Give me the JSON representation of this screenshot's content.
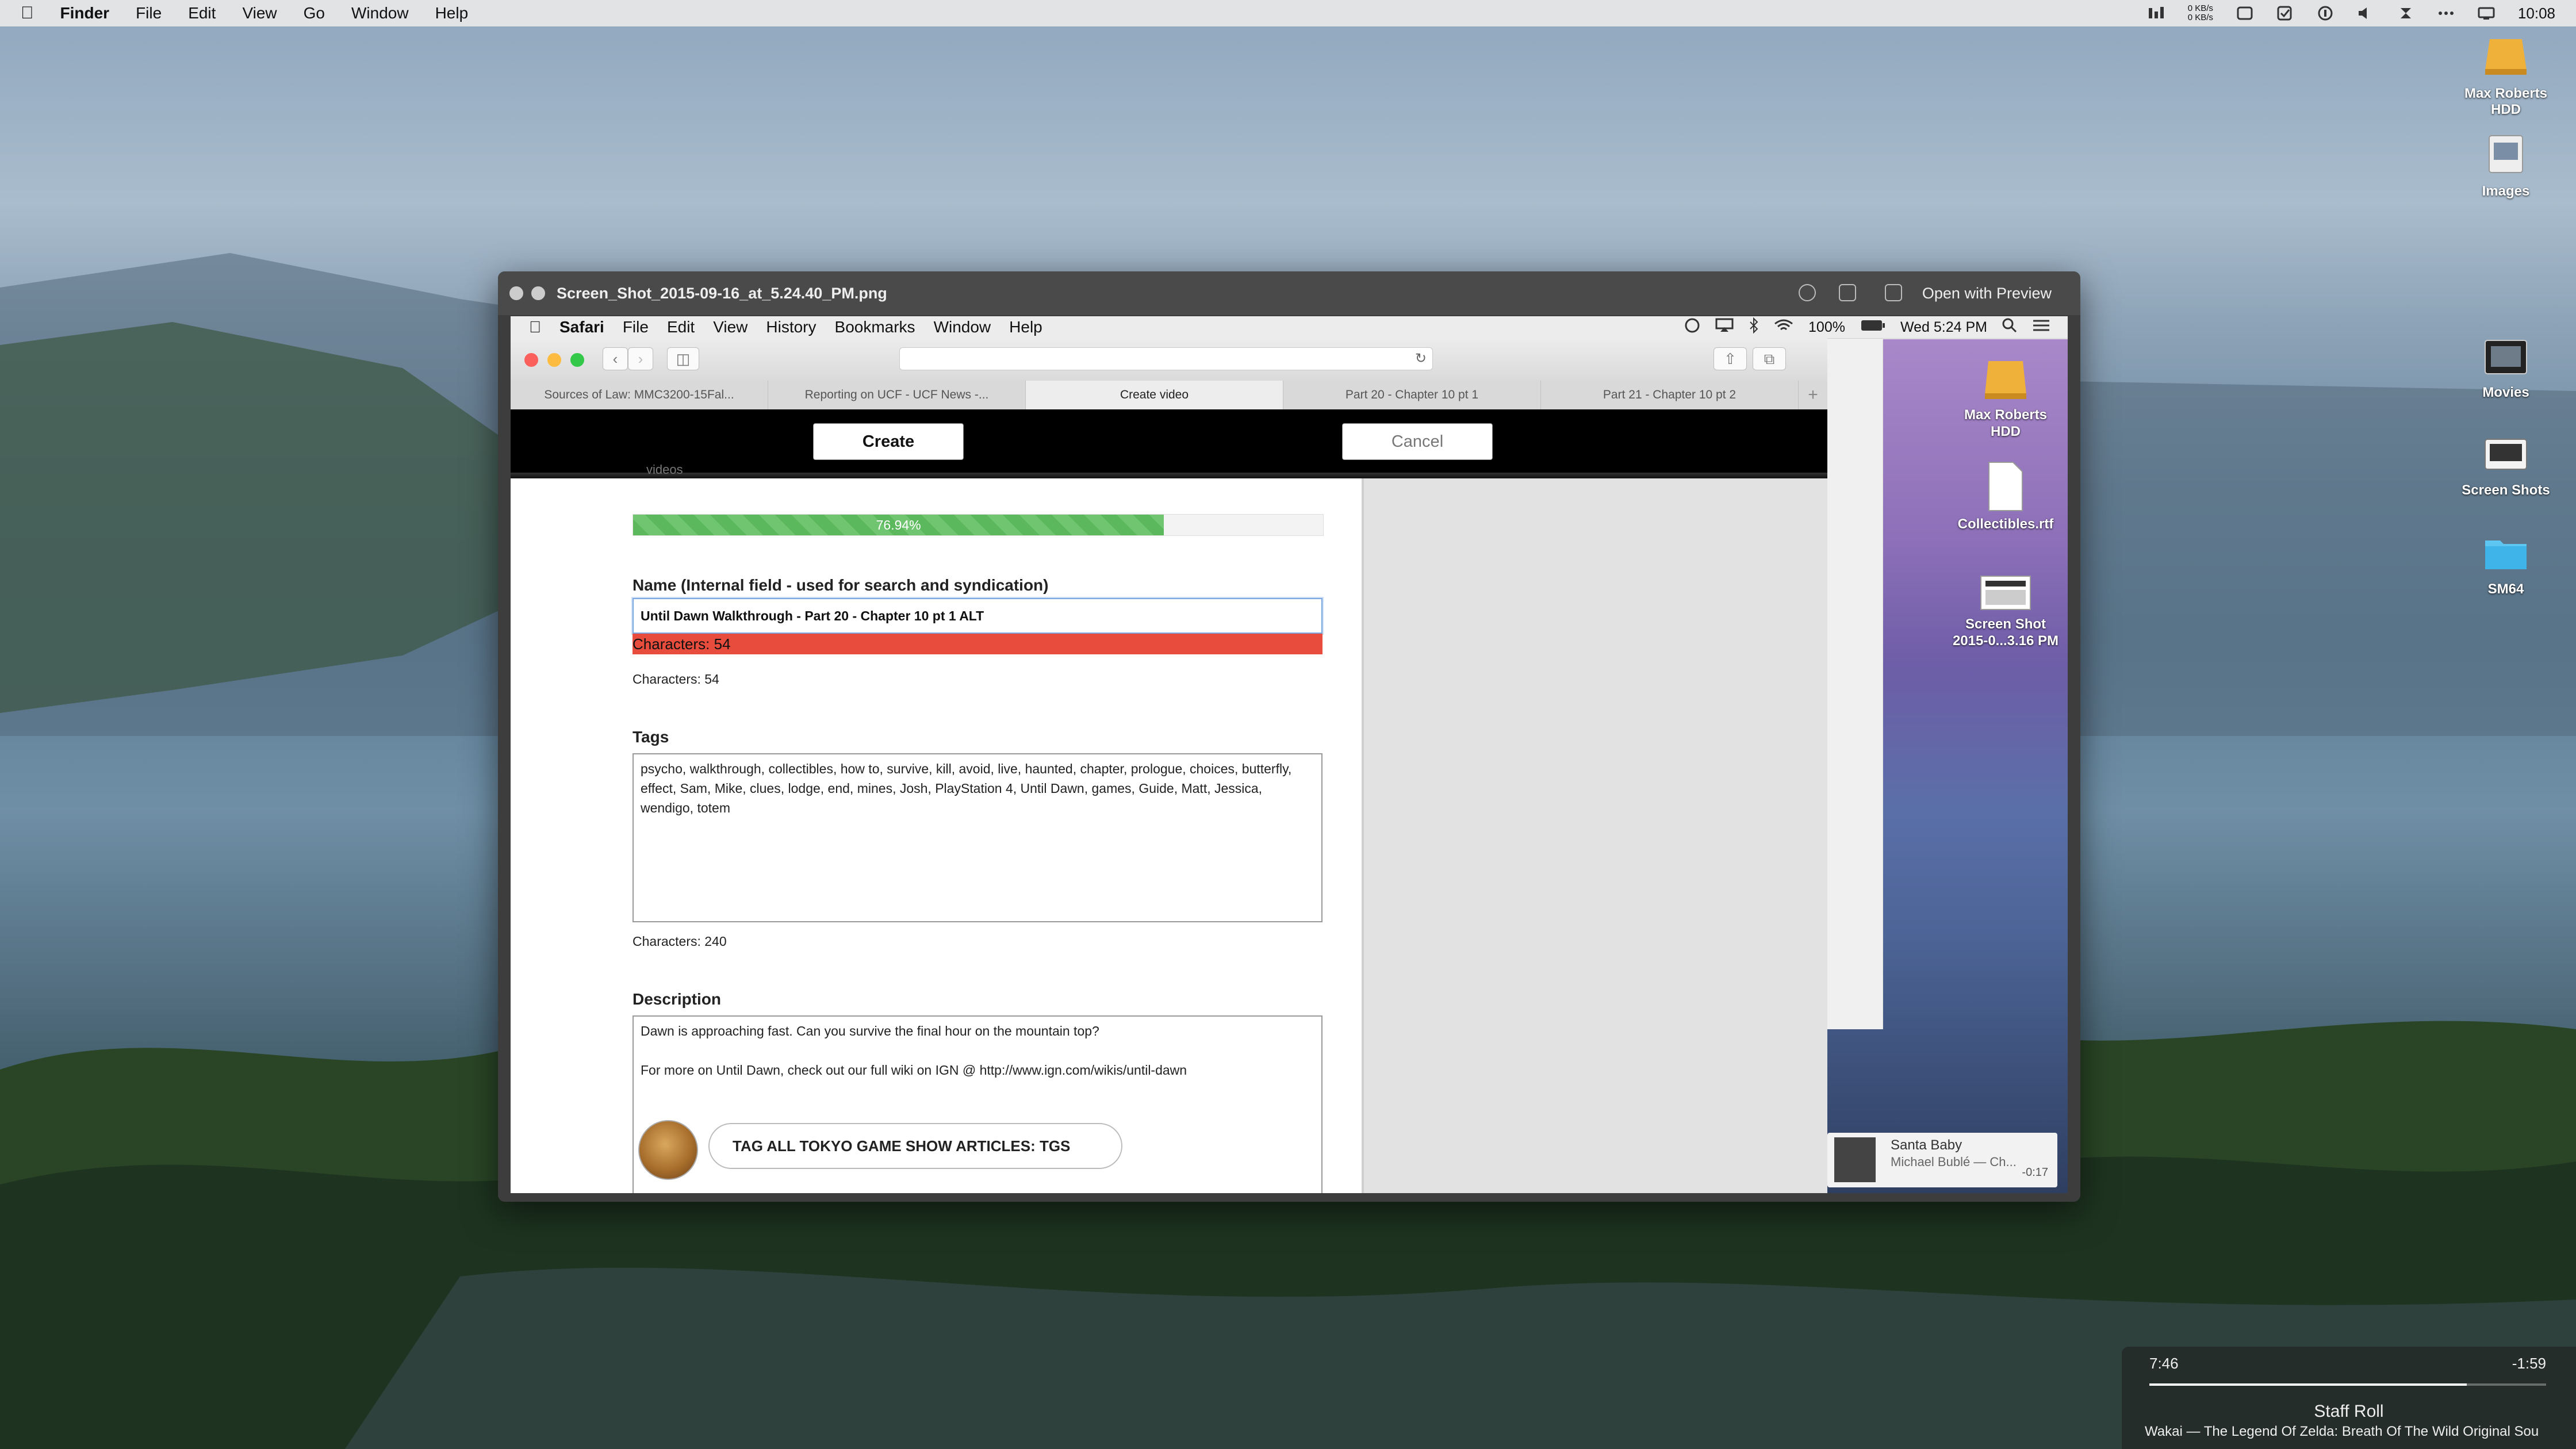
{
  "menubar": {
    "app": "Finder",
    "items": [
      "File",
      "Edit",
      "View",
      "Go",
      "Window",
      "Help"
    ],
    "net_up": "0 KB/s",
    "net_down": "0 KB/s",
    "clock": "10:08"
  },
  "desktop_icons": [
    {
      "label": "Max Roberts HDD",
      "icon": "hard-drive-icon"
    },
    {
      "label": "Images",
      "icon": "folder-icon"
    },
    {
      "label": "Movies",
      "icon": "folder-icon"
    },
    {
      "label": "Screen Shots",
      "icon": "folder-icon"
    },
    {
      "label": "SM64",
      "icon": "folder-icon"
    }
  ],
  "preview": {
    "filename": "Screen_Shot_2015-09-16_at_5.24.40_PM.png",
    "open_with": "Open with Preview"
  },
  "inner_menubar": {
    "app": "Safari",
    "items": [
      "File",
      "Edit",
      "View",
      "History",
      "Bookmarks",
      "Window",
      "Help"
    ],
    "battery": "100%",
    "clock": "Wed 5:24 PM"
  },
  "inner_desktop_icons": [
    {
      "label": "Max Roberts HDD"
    },
    {
      "label": "Collectibles.rtf"
    },
    {
      "label": "Screen Shot 2015-0...3.16 PM"
    }
  ],
  "itunes": {
    "title": "Santa Baby",
    "artist": "Michael Bublé — Ch...",
    "remaining": "-0:17"
  },
  "tabs": [
    "Sources of Law: MMC3200-15Fal...",
    "Reporting on UCF - UCF News -...",
    "Create video",
    "Part 20 - Chapter 10 pt 1",
    "Part 21 - Chapter 10 pt 2"
  ],
  "actions": {
    "create": "Create",
    "cancel": "Cancel"
  },
  "form": {
    "peek_label": "videos",
    "progress_label": "76.94%",
    "progress_value": 0.7694,
    "name_label": "Name (Internal field - used for search and syndication)",
    "name_value": "Until Dawn Walkthrough - Part 20 - Chapter 10 pt 1 ALT",
    "name_warning": "Characters: 54",
    "name_count": "Characters: 54",
    "tags_label": "Tags",
    "tags_value": "psycho, walkthrough, collectibles, how to, survive, kill, avoid, live, haunted, chapter, prologue, choices, butterfly, effect, Sam, Mike, clues, lodge, end, mines, Josh, PlayStation 4, Until Dawn, games, Guide, Matt, Jessica, wendigo, totem",
    "tags_count": "Characters: 240",
    "description_label": "Description",
    "description_line1": "Dawn is approaching fast. Can you survive the final hour on the mountain top?",
    "description_line2": "For more on Until Dawn, check out our full wiki on IGN @ http://www.ign.com/wikis/until-dawn",
    "tag_pill": "TAG ALL TOKYO GAME SHOW ARTICLES: TGS"
  },
  "now_playing": {
    "elapsed": "7:46",
    "remaining": "-1:59",
    "title": "Staff Roll",
    "subtitle": "Wakai — The Legend Of Zelda: Breath Of The Wild Original Sou",
    "progress": 0.8
  },
  "colors": {
    "progress": "#5cb85c",
    "warning": "#e74c3c",
    "focus": "#7aa7e0"
  }
}
